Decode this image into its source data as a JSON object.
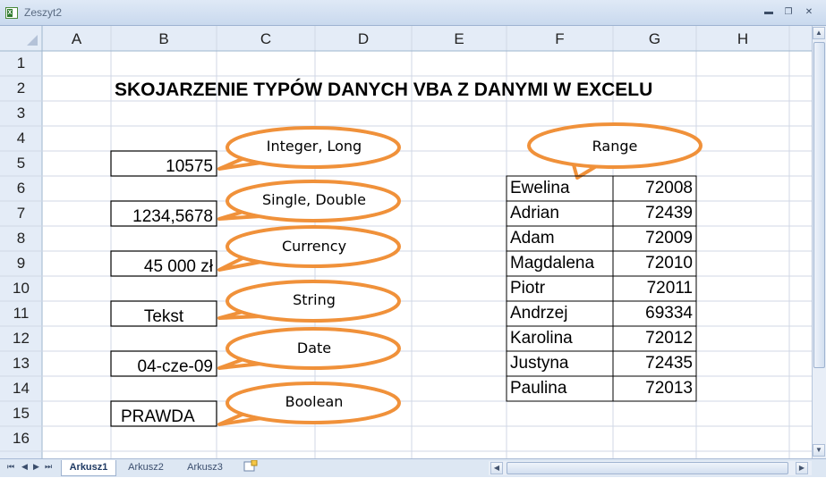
{
  "window": {
    "title": "Zeszyt2",
    "app_icon_letter": "X",
    "minimize": "▬",
    "restore": "❐",
    "close": "✕"
  },
  "columns": [
    "A",
    "B",
    "C",
    "D",
    "E",
    "F",
    "G",
    "H"
  ],
  "rows": [
    "1",
    "2",
    "3",
    "4",
    "5",
    "6",
    "7",
    "8",
    "9",
    "10",
    "11",
    "12",
    "13",
    "14",
    "15",
    "16"
  ],
  "title": "SKOJARZENIE TYPÓW DANYCH VBA Z DANYMI W EXCELU",
  "values": {
    "b5": "10575",
    "b7": "1234,5678",
    "b9": "45 000 zł",
    "b11": "Tekst",
    "b13": "04-cze-09",
    "b15": "PRAWDA"
  },
  "bubbles": {
    "integer": "Integer, Long",
    "single": "Single, Double",
    "currency": "Currency",
    "string": "String",
    "date": "Date",
    "boolean": "Boolean",
    "range": "Range"
  },
  "range_table": [
    {
      "name": "Ewelina",
      "value": "72008"
    },
    {
      "name": "Adrian",
      "value": "72439"
    },
    {
      "name": "Adam",
      "value": "72009"
    },
    {
      "name": "Magdalena",
      "value": "72010"
    },
    {
      "name": "Piotr",
      "value": "72011"
    },
    {
      "name": "Andrzej",
      "value": "69334"
    },
    {
      "name": "Karolina",
      "value": "72012"
    },
    {
      "name": "Justyna",
      "value": "72435"
    },
    {
      "name": "Paulina",
      "value": "72013"
    }
  ],
  "sheet_tabs": [
    "Arkusz1",
    "Arkusz2",
    "Arkusz3"
  ],
  "nav": {
    "first": "⏮",
    "prev": "◀",
    "next": "▶",
    "last": "⏭"
  },
  "scroll": {
    "up": "▲",
    "down": "▼",
    "left": "◀",
    "right": "▶"
  },
  "colors": {
    "bubble_stroke": "#f0913a",
    "header_bg": "#e4ecf7",
    "gridline": "#d0d7e5",
    "accent": "#1f3a63"
  }
}
